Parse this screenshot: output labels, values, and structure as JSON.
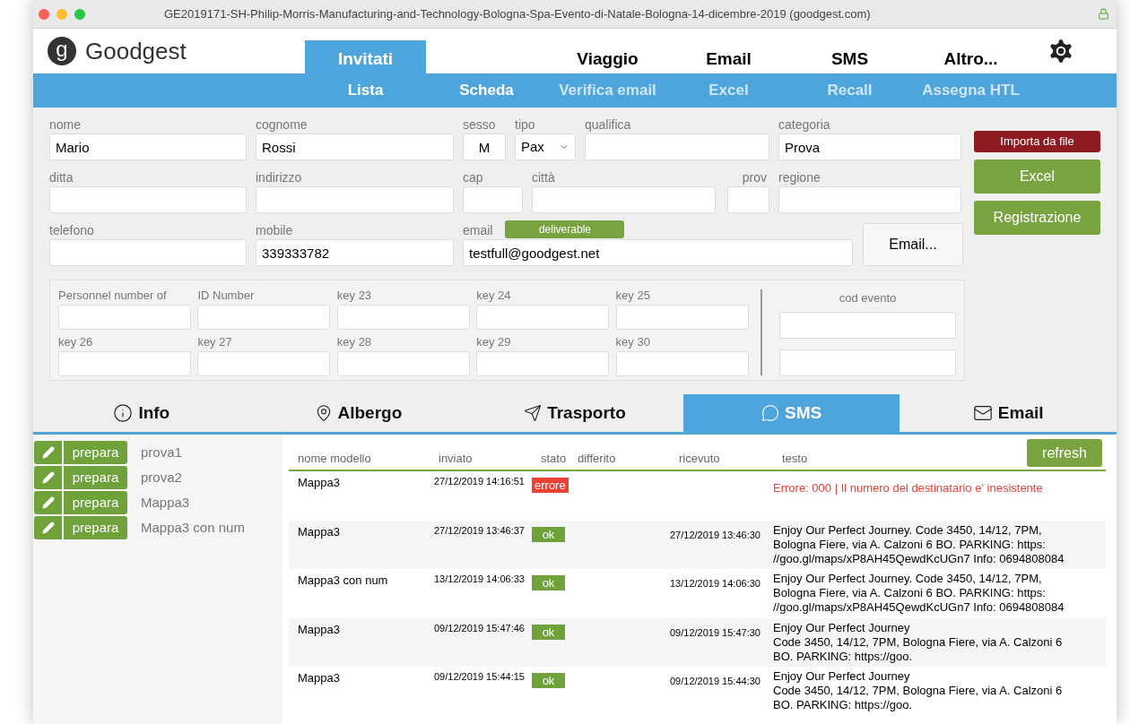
{
  "window": {
    "title": "GE2019171-SH-Philip-Morris-Manufacturing-and-Technology-Bologna-Spa-Evento-di-Natale-Bologna-14-dicembre-2019 (goodgest.com)"
  },
  "logo": {
    "mark": "g",
    "name": "Goodgest"
  },
  "nav": [
    {
      "label": "Invitati",
      "selected": true
    },
    {
      "label": "Viaggio",
      "selected": false
    },
    {
      "label": "Email",
      "selected": false
    },
    {
      "label": "SMS",
      "selected": false
    },
    {
      "label": "Altro...",
      "selected": false
    }
  ],
  "subnav": [
    {
      "label": "Lista",
      "disabled": false
    },
    {
      "label": "Scheda",
      "disabled": false
    },
    {
      "label": "Verifica email",
      "disabled": true
    },
    {
      "label": "Excel",
      "disabled": true
    },
    {
      "label": "Recall",
      "disabled": true
    },
    {
      "label": "Assegna HTL",
      "disabled": true
    }
  ],
  "form": {
    "nome": {
      "label": "nome",
      "value": "Mario"
    },
    "cognome": {
      "label": "cognome",
      "value": "Rossi"
    },
    "sesso": {
      "label": "sesso",
      "value": "M"
    },
    "tipo": {
      "label": "tipo",
      "value": "Pax"
    },
    "qualifica": {
      "label": "qualifica"
    },
    "categoria": {
      "label": "categoria",
      "value": "Prova"
    },
    "ditta": {
      "label": "ditta"
    },
    "indirizzo": {
      "label": "indirizzo"
    },
    "cap": {
      "label": "cap"
    },
    "citta": {
      "label": "città"
    },
    "prov": {
      "label": "prov"
    },
    "regione": {
      "label": "regione"
    },
    "telefono": {
      "label": "telefono"
    },
    "mobile": {
      "label": "mobile",
      "value": "339333782"
    },
    "email": {
      "label": "email",
      "value": "testfull@goodgest.net",
      "badge": "deliverable"
    },
    "email_button": "Email..."
  },
  "actions": [
    {
      "label": "Importa da file",
      "kind": "danger"
    },
    {
      "label": "Excel",
      "kind": "primary"
    },
    {
      "label": "Registrazione",
      "kind": "primary"
    }
  ],
  "keys": [
    {
      "label": "Personnel number of"
    },
    {
      "label": "ID Number"
    },
    {
      "label": "key 23"
    },
    {
      "label": "key 24"
    },
    {
      "label": "key 25"
    },
    {
      "label": "key 26"
    },
    {
      "label": "key 27"
    },
    {
      "label": "key 28"
    },
    {
      "label": "key 29"
    },
    {
      "label": "key 30"
    }
  ],
  "cod_evento": {
    "label": "cod evento"
  },
  "tabs": [
    {
      "label": "Info",
      "kind": "info",
      "selected": false
    },
    {
      "label": "Albergo",
      "kind": "hotel",
      "selected": false
    },
    {
      "label": "Trasporto",
      "kind": "transport",
      "selected": false
    },
    {
      "label": "SMS",
      "kind": "sms",
      "selected": true
    },
    {
      "label": "Email",
      "kind": "email",
      "selected": false
    }
  ],
  "templates": [
    {
      "button": "prepara",
      "name": "prova1"
    },
    {
      "button": "prepara",
      "name": "prova2"
    },
    {
      "button": "prepara",
      "name": "Mappa3"
    },
    {
      "button": "prepara",
      "name": "Mappa3 con num"
    }
  ],
  "refresh": "refresh",
  "table": {
    "columns": [
      "nome modello",
      "inviato",
      "stato",
      "differito",
      "ricevuto",
      "testo"
    ],
    "rows": [
      {
        "nome": "Mappa3",
        "inviato": "27/12/2019 14:16:51",
        "stato": {
          "label": "errore",
          "kind": "error"
        },
        "ricevuto": "",
        "testo": [
          "Errore: 000 |  Il numero del destinatario e' inesistente"
        ]
      },
      {
        "nome": "Mappa3",
        "inviato": "27/12/2019 13:46:37",
        "stato": {
          "label": "ok",
          "kind": "ok"
        },
        "ricevuto": "27/12/2019 13:46:30",
        "testo": [
          "Enjoy Our Perfect Journey. Code 3450, 14/12, 7PM,",
          "Bologna Fiere, via A. Calzoni 6 BO. PARKING: https:",
          "//goo.gl/maps/xP8AH45QewdKcUGn7 Info: 0694808084"
        ]
      },
      {
        "nome": "Mappa3 con num",
        "inviato": "13/12/2019 14:06:33",
        "stato": {
          "label": "ok",
          "kind": "ok"
        },
        "ricevuto": "13/12/2019 14:06:30",
        "testo": [
          "Enjoy Our Perfect Journey. Code 3450, 14/12, 7PM,",
          "Bologna Fiere, via A. Calzoni 6 BO. PARKING: https:",
          "//goo.gl/maps/xP8AH45QewdKcUGn7 Info: 0694808084"
        ]
      },
      {
        "nome": "Mappa3",
        "inviato": "09/12/2019 15:47:46",
        "stato": {
          "label": "ok",
          "kind": "ok"
        },
        "ricevuto": "09/12/2019 15:47:30",
        "testo": [
          "Enjoy Our Perfect Journey",
          "Code 3450, 14/12, 7PM, Bologna Fiere, via A. Calzoni 6",
          "BO. PARKING: https://goo."
        ]
      },
      {
        "nome": "Mappa3",
        "inviato": "09/12/2019 15:44:15",
        "stato": {
          "label": "ok",
          "kind": "ok"
        },
        "ricevuto": "09/12/2019 15:44:30",
        "testo": [
          "Enjoy Our Perfect Journey",
          "Code 3450, 14/12, 7PM, Bologna Fiere, via A. Calzoni 6",
          "BO. PARKING: https://goo."
        ]
      }
    ]
  }
}
